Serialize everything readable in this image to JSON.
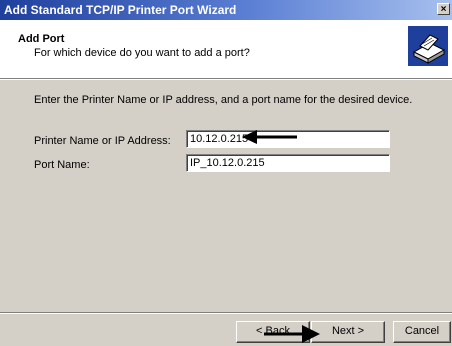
{
  "window": {
    "title": "Add Standard TCP/IP Printer Port Wizard",
    "close_label": "×"
  },
  "header": {
    "title": "Add Port",
    "subtitle": "For which device do you want to add a port?",
    "icon": "printer-port-icon"
  },
  "main": {
    "instruction": "Enter the Printer Name or IP address, and a port name for the desired device.",
    "printer_label": "Printer Name or IP Address:",
    "printer_value": "10.12.0.215",
    "port_label": "Port Name:",
    "port_value": "IP_10.12.0.215"
  },
  "buttons": {
    "back": "< Back",
    "next": "Next >",
    "cancel": "Cancel"
  },
  "annotations": {
    "arrow_color": "#000000"
  }
}
